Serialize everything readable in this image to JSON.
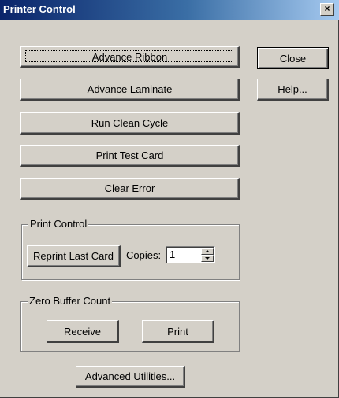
{
  "window": {
    "title": "Printer Control",
    "close_glyph": "×"
  },
  "actions": {
    "advance_ribbon": "Advance Ribbon",
    "advance_laminate": "Advance Laminate",
    "run_clean_cycle": "Run Clean Cycle",
    "print_test_card": "Print Test Card",
    "clear_error": "Clear Error"
  },
  "side_buttons": {
    "close": "Close",
    "help": "Help..."
  },
  "print_control": {
    "group_label": "Print Control",
    "reprint_label": "Reprint Last Card",
    "copies_label": "Copies:",
    "copies_value": "1"
  },
  "zero_buffer": {
    "group_label": "Zero Buffer Count",
    "receive_label": "Receive",
    "print_label": "Print"
  },
  "footer": {
    "advanced_label": "Advanced Utilities..."
  },
  "colors": {
    "face": "#d4d0c8",
    "title_start": "#0a246a",
    "title_end": "#a6caf0"
  }
}
